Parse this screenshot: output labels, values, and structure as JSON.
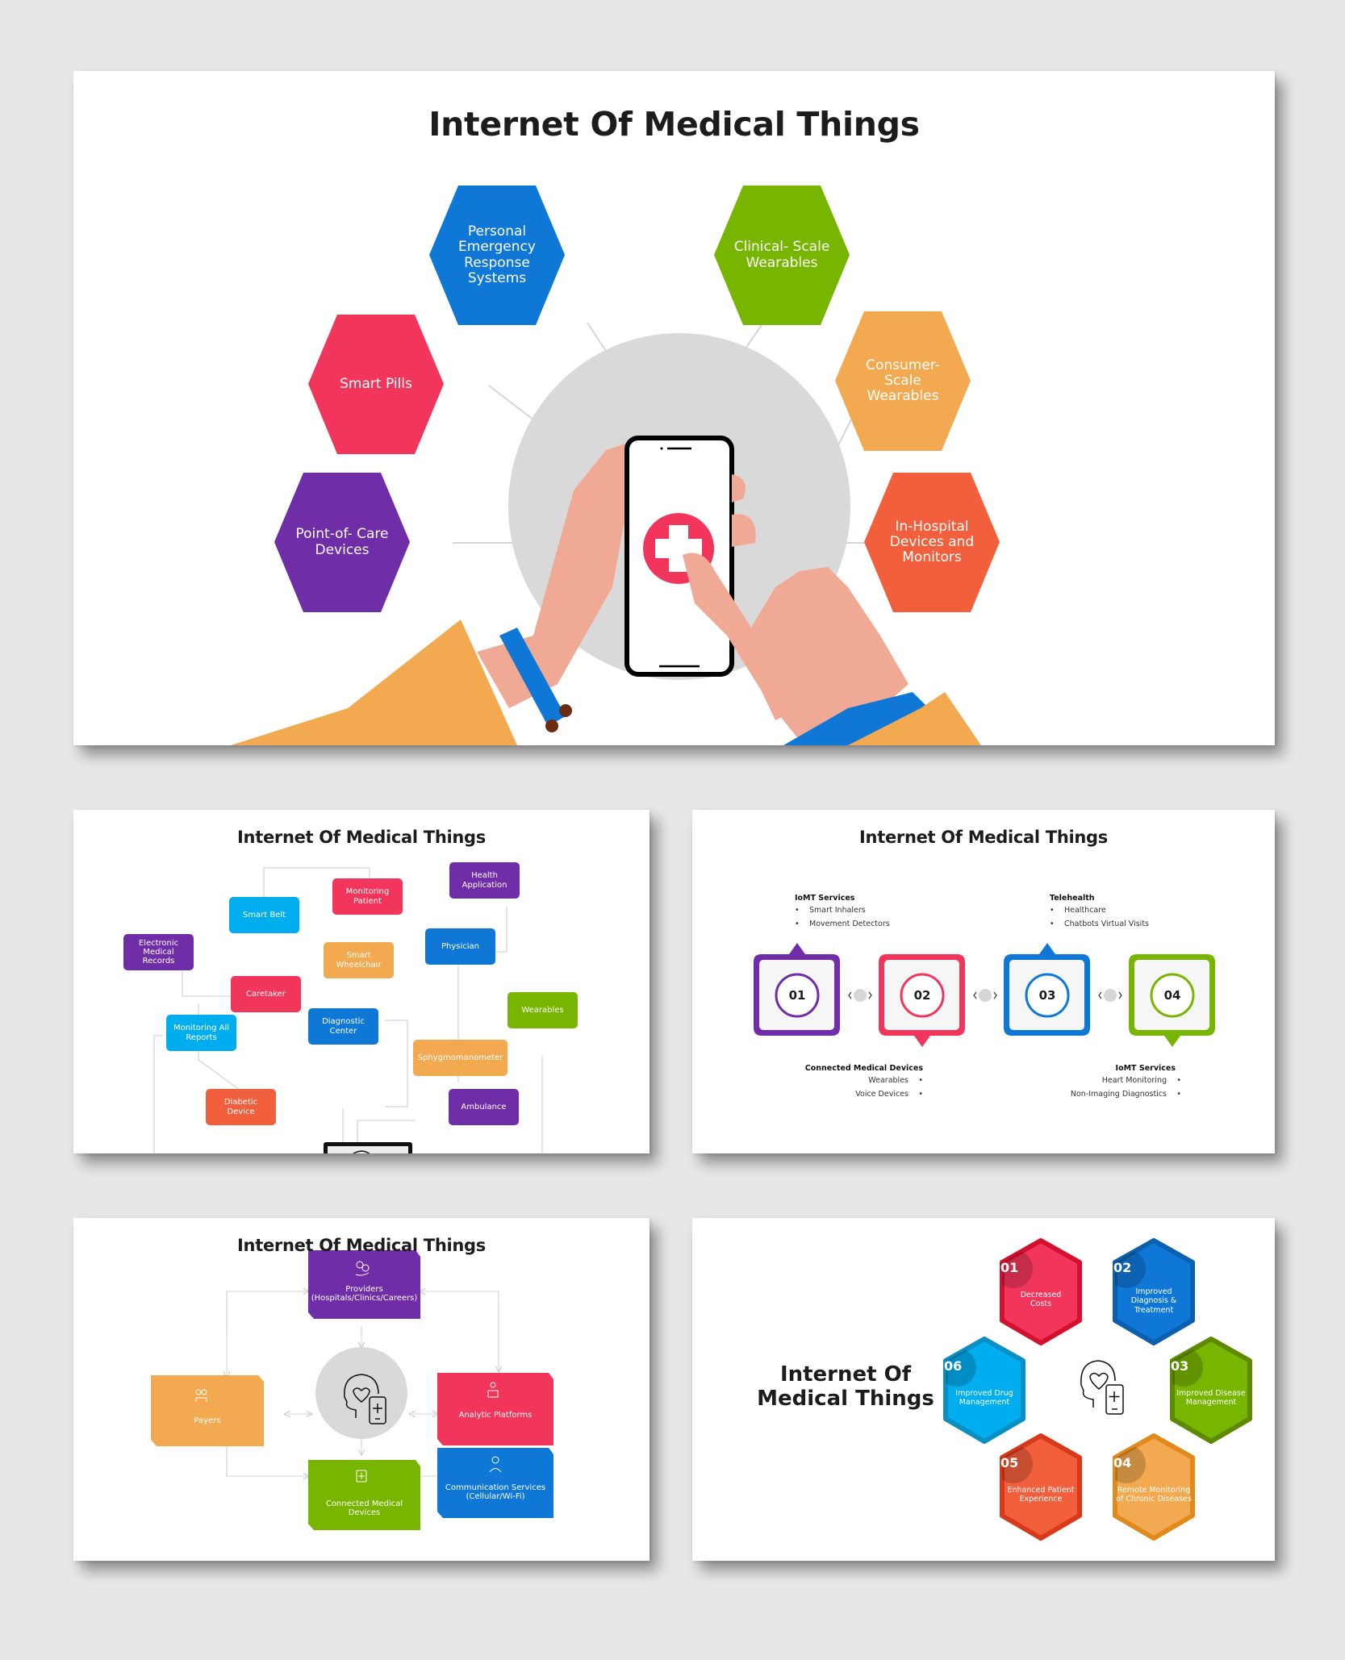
{
  "colors": {
    "background": "#e7e7e7",
    "purple": "#6f2da8",
    "blue": "#0f78d7",
    "pink": "#f2355a",
    "green": "#77b500",
    "orange": "#f2a94f",
    "red_orange": "#f25f3c",
    "cyan": "#00adee",
    "gray_circle": "#d9d9d9",
    "skin": "#efa995",
    "sleeve": "#f2a94f",
    "cuff": "#0f78d7",
    "title_text": "#1c1c1c"
  },
  "slides": [
    {
      "id": "slide-1",
      "title": "Internet Of Medical Things",
      "hexagons": [
        {
          "label": "Personal\nEmergency\nResponse\nSystems",
          "color": "blue"
        },
        {
          "label": "Clinical- Scale\nWearables",
          "color": "green"
        },
        {
          "label": "Smart Pills",
          "color": "pink"
        },
        {
          "label": "Consumer-\nScale\nWearables",
          "color": "orange"
        },
        {
          "label": "Point-of- Care\nDevices",
          "color": "purple"
        },
        {
          "label": "In-Hospital\nDevices and\nMonitors",
          "color": "red_orange"
        }
      ],
      "center_icon": "hand-holding-phone-medical-cross-icon"
    },
    {
      "id": "slide-2",
      "title": "Internet Of Medical Things",
      "nodes": [
        {
          "label": "Smart Belt",
          "color": "cyan"
        },
        {
          "label": "Monitoring\nPatient",
          "color": "pink"
        },
        {
          "label": "Health\nApplication",
          "color": "purple"
        },
        {
          "label": "Electronic\nMedical\nRecords",
          "color": "purple"
        },
        {
          "label": "Smart\nWheelchair",
          "color": "orange"
        },
        {
          "label": "Physician",
          "color": "blue"
        },
        {
          "label": "Caretaker",
          "color": "pink"
        },
        {
          "label": "Wearables",
          "color": "green"
        },
        {
          "label": "Monitoring All\nReports",
          "color": "cyan"
        },
        {
          "label": "Diagnostic\nCenter",
          "color": "blue"
        },
        {
          "label": "Sphygmomanometer",
          "color": "orange"
        },
        {
          "label": "Diabetic\nDevice",
          "color": "red_orange"
        },
        {
          "label": "Ambulance",
          "color": "purple"
        }
      ],
      "center_icon": "laptop-head-heart-phone-icon"
    },
    {
      "id": "slide-3",
      "title": "Internet Of Medical Things",
      "steps": [
        {
          "number": "01",
          "color": "purple",
          "pointer": "up"
        },
        {
          "number": "02",
          "color": "pink",
          "pointer": "down"
        },
        {
          "number": "03",
          "color": "blue",
          "pointer": "up"
        },
        {
          "number": "04",
          "color": "green",
          "pointer": "down"
        }
      ],
      "top_notes": [
        {
          "heading": "IoMT Services",
          "items": [
            "Smart Inhalers",
            "Movement Detectors"
          ]
        },
        {
          "heading": "Telehealth",
          "items": [
            "Healthcare",
            "Chatbots Virtual Visits"
          ]
        }
      ],
      "bottom_notes": [
        {
          "heading": "Connected Medical Devices",
          "items": [
            "Wearables",
            "Voice Devices"
          ]
        },
        {
          "heading": "IoMT Services",
          "items": [
            "Heart Monitoring",
            "Non-Imaging Diagnostics"
          ]
        }
      ]
    },
    {
      "id": "slide-4",
      "title": "Internet Of Medical Things",
      "boxes": [
        {
          "label": "Providers\n(Hospitals/Clinics/Careers)",
          "color": "purple",
          "icon": "gears-hand-icon"
        },
        {
          "label": "Payers",
          "color": "orange",
          "icon": "person-coins-icon"
        },
        {
          "label": "Analytic Platforms",
          "color": "pink",
          "icon": "analytics-person-icon"
        },
        {
          "label": "Communication Services\n(Cellular/Wi-Fi)",
          "color": "blue",
          "icon": "headset-agent-icon"
        },
        {
          "label": "Connected Medical\nDevices",
          "color": "green",
          "icon": "medical-device-icon"
        }
      ],
      "center_icon": "head-heart-phone-icon"
    },
    {
      "id": "slide-5",
      "title": "Internet Of\nMedical Things",
      "benefits": [
        {
          "number": "01",
          "label": "Decreased\nCosts",
          "color": "pink"
        },
        {
          "number": "02",
          "label": "Improved\nDiagnosis &\nTreatment",
          "color": "blue"
        },
        {
          "number": "03",
          "label": "Improved Disease\nManagement",
          "color": "green"
        },
        {
          "number": "04",
          "label": "Remote Monitoring\nof Chronic Diseases",
          "color": "orange"
        },
        {
          "number": "05",
          "label": "Enhanced Patient\nExperience",
          "color": "red_orange"
        },
        {
          "number": "06",
          "label": "Improved Drug\nManagement",
          "color": "cyan"
        }
      ],
      "center_icon": "head-heart-phone-icon"
    }
  ]
}
